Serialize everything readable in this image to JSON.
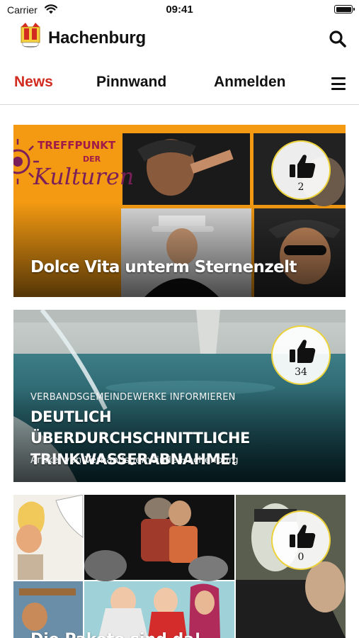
{
  "status_bar": {
    "carrier": "Carrier",
    "time": "09:41",
    "icons": [
      "wifi-icon",
      "battery-icon"
    ]
  },
  "header": {
    "title": "Hachenburg",
    "logo": "hachenburg-coat-of-arms",
    "search_icon": "search-icon"
  },
  "tabs": [
    {
      "label": "News",
      "active": true
    },
    {
      "label": "Pinnwand",
      "active": false
    },
    {
      "label": "Anmelden",
      "active": false
    }
  ],
  "menu_icon": "hamburger-menu-icon",
  "colors": {
    "accent": "#d22b20",
    "like_badge_border": "#ecd23b",
    "card1_background": "#f39a12"
  },
  "cards": [
    {
      "kicker": "",
      "image_text": {
        "line1": "TREFFPUNKT",
        "line2": "DER",
        "line3": "Kulturen"
      },
      "title": "Dolce Vita unterm Sternenzelt",
      "author": "",
      "likes": "2"
    },
    {
      "kicker": "VERBANDSGEMEINDEWERKE INFORMIEREN",
      "title_line1": "DEUTLICH ÜBERDURCHSCHNITTLICHE",
      "title_line2": "TRINKWASSERABNAHME!",
      "author": "Artikel von Verbandsgemeinde Hachenburg",
      "likes": "34"
    },
    {
      "kicker": "",
      "title": "Die Pakete sind da!",
      "author": "",
      "likes": "0"
    }
  ]
}
